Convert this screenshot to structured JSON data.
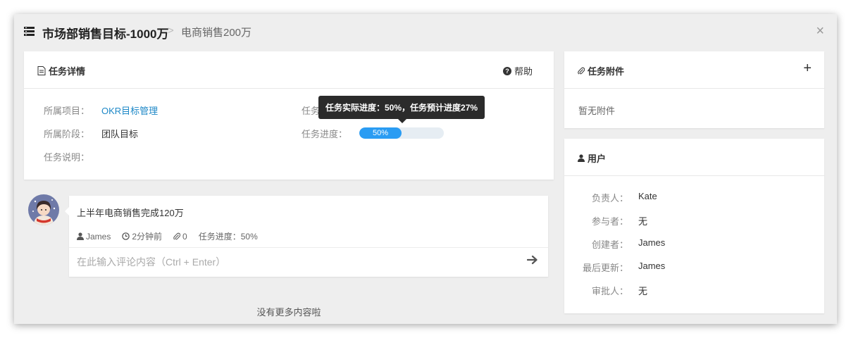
{
  "header": {
    "title": "市场部销售目标-1000万",
    "separator": ">",
    "subtitle": "电商销售200万",
    "close_label": "×"
  },
  "detail": {
    "title": "任务详情",
    "help_label": "帮助",
    "rows": [
      {
        "label": "所属项目：",
        "value": "OKR目标管理"
      },
      {
        "label": "所属阶段：",
        "value": "团队目标"
      },
      {
        "label": "任务说明：",
        "value": ""
      }
    ],
    "right_rows": [
      {
        "label": "任务"
      },
      {
        "label": "任务进度："
      }
    ],
    "progress_percent": 50,
    "progress_text": "50%",
    "tooltip": "任务实际进度：50%，任务预计进度27%"
  },
  "comment": {
    "text": "上半年电商销售完成120万",
    "author": "James",
    "time": "2分钟前",
    "attachments": "0",
    "progress": "任务进度：50%",
    "input_placeholder": "在此输入评论内容（Ctrl + Enter）",
    "no_more": "没有更多内容啦"
  },
  "attachments": {
    "title": "任务附件",
    "add_label": "+",
    "empty": "暂无附件"
  },
  "users": {
    "title": "用户",
    "rows": [
      {
        "label": "负责人：",
        "value": "Kate"
      },
      {
        "label": "参与者：",
        "value": "无"
      },
      {
        "label": "创建者：",
        "value": "James"
      },
      {
        "label": "最后更新：",
        "value": "James"
      },
      {
        "label": "审批人：",
        "value": "无"
      }
    ]
  },
  "colors": {
    "accent": "#2a9cf3",
    "link": "#1e88c7",
    "modal_bg": "#eeeeee"
  },
  "icons": {
    "title": "list-icon",
    "detail": "document-icon",
    "help": "question-circle-icon",
    "attachment": "paperclip-icon",
    "users": "user-icon",
    "send": "arrow-right-icon"
  }
}
